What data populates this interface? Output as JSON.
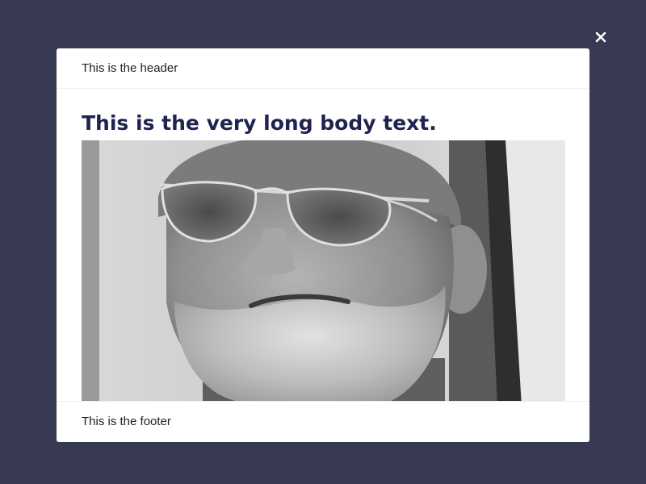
{
  "modal": {
    "header_text": "This is the header",
    "body_title": "This is the very long body text.",
    "footer_text": "This is the footer",
    "image": {
      "icon": "photo-portrait-bearded-man-sunglasses",
      "tone": "grayscale"
    }
  },
  "close_button": {
    "icon": "close-icon",
    "color": "#ffffff"
  },
  "colors": {
    "backdrop": "#373a52",
    "modal_background": "#ffffff",
    "title_text": "#1e2350",
    "body_text": "#222222"
  }
}
